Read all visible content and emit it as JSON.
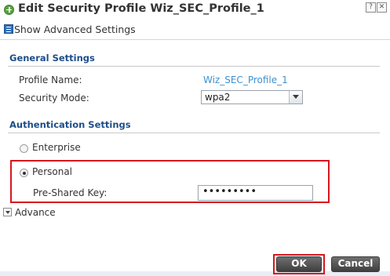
{
  "window": {
    "title": "Edit Security Profile Wiz_SEC_Profile_1",
    "help_label": "?",
    "close_label": "✕"
  },
  "toolbar": {
    "show_advanced_label": "Show Advanced Settings"
  },
  "general": {
    "heading": "General Settings",
    "profile_name_label": "Profile Name:",
    "profile_name_value": "Wiz_SEC_Profile_1",
    "security_mode_label": "Security Mode:",
    "security_mode_value": "wpa2"
  },
  "auth": {
    "heading": "Authentication Settings",
    "options": [
      {
        "label": "Enterprise",
        "selected": false
      },
      {
        "label": "Personal",
        "selected": true
      }
    ],
    "psk_label": "Pre-Shared Key:",
    "psk_value": "•••••••••"
  },
  "advance": {
    "label": "Advance"
  },
  "buttons": {
    "ok": "OK",
    "cancel": "Cancel"
  },
  "colors": {
    "section_heading": "#1d4e8a",
    "link": "#3d91d1",
    "highlight": "#d6161e",
    "title_icon": "#5aa142"
  }
}
